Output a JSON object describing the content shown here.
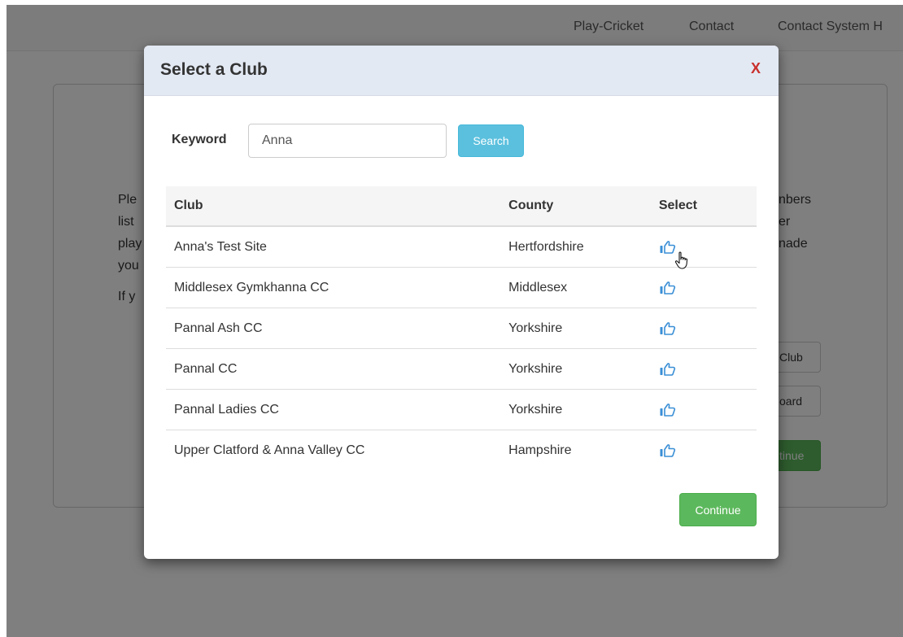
{
  "nav": {
    "links": [
      "Play-Cricket",
      "Contact",
      "Contact System H"
    ]
  },
  "background": {
    "text_left": [
      "Ple",
      "list",
      "play",
      "you",
      "If y"
    ],
    "text_right": [
      "nbers",
      "er",
      "nade"
    ],
    "buttons": [
      "Club",
      "oard",
      "tinue"
    ]
  },
  "modal": {
    "title": "Select a Club",
    "close_label": "X",
    "search": {
      "label": "Keyword",
      "value": "Anna",
      "placeholder": "",
      "button_label": "Search"
    },
    "table": {
      "headers": {
        "club": "Club",
        "county": "County",
        "select": "Select"
      },
      "rows": [
        {
          "club": "Anna's Test Site",
          "county": "Hertfordshire"
        },
        {
          "club": "Middlesex Gymkhanna CC",
          "county": "Middlesex"
        },
        {
          "club": "Pannal Ash CC",
          "county": "Yorkshire"
        },
        {
          "club": "Pannal CC",
          "county": "Yorkshire"
        },
        {
          "club": "Pannal Ladies CC",
          "county": "Yorkshire"
        },
        {
          "club": "Upper Clatford & Anna Valley CC",
          "county": "Hampshire"
        }
      ],
      "select_icon": "thumbs-up-icon"
    },
    "continue_label": "Continue"
  },
  "colors": {
    "header_bg": "#e3e9f3",
    "close": "#c9302c",
    "info_button": "#5bc0de",
    "success_button": "#5cb85c",
    "icon_blue": "#3a8fd6"
  }
}
